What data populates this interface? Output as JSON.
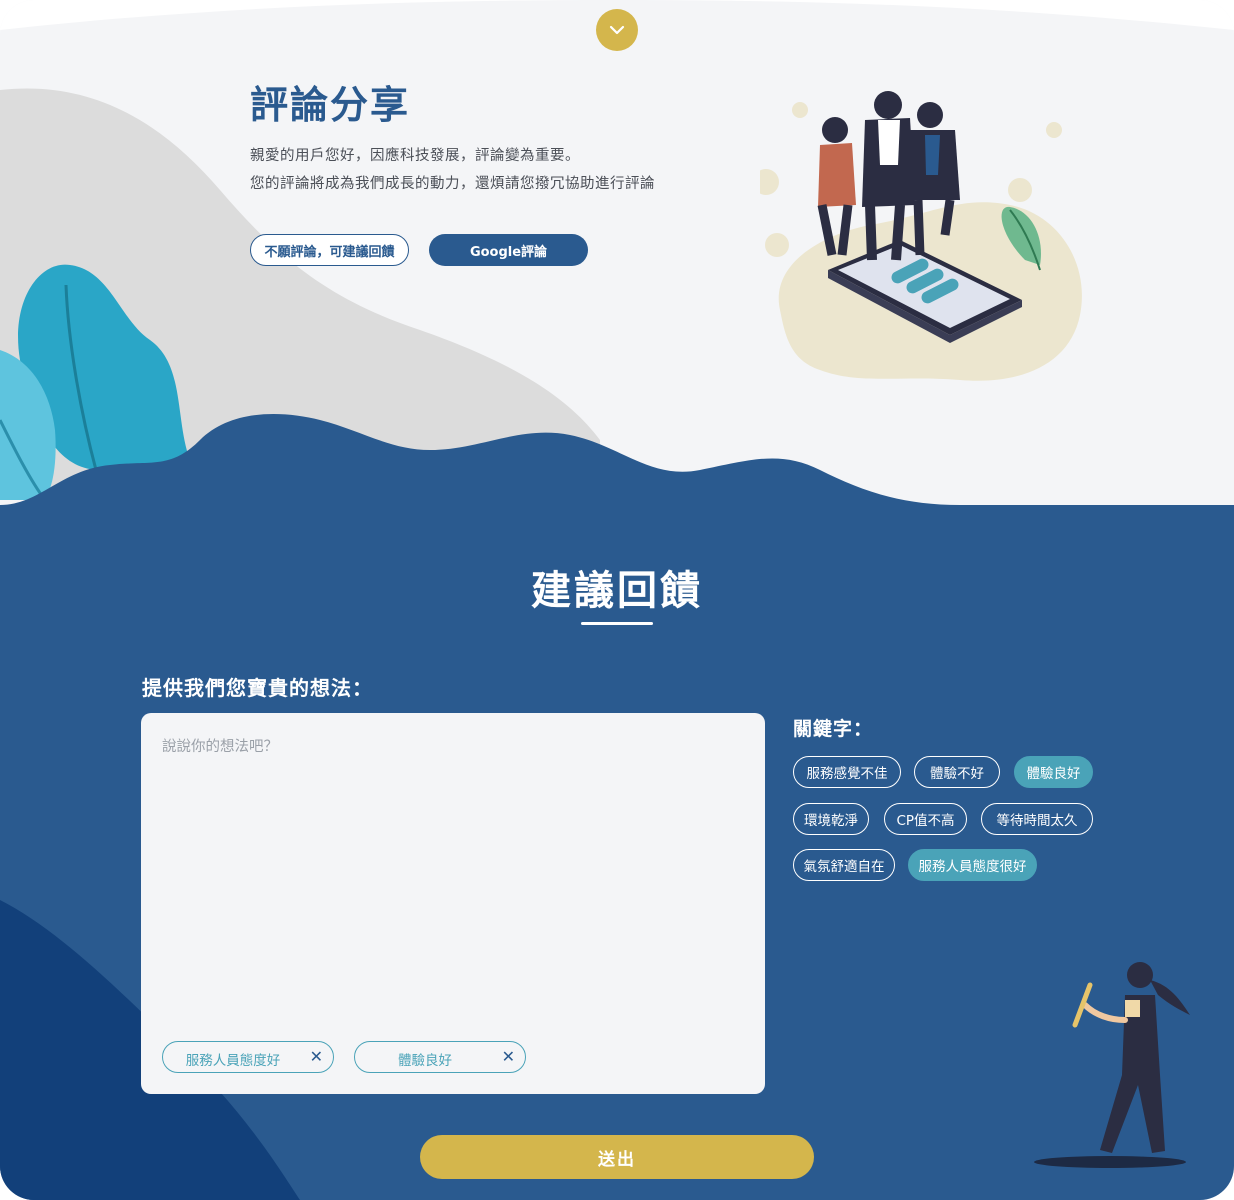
{
  "hero": {
    "title": "評論分享",
    "line1": "親愛的用戶您好，因應科技發展，評論變為重要。",
    "line2": "您的評論將成為我們成長的動力，還煩請您撥冗協助進行評論",
    "decline_button": "不願評論，可建議回饋",
    "google_button": "Google評論"
  },
  "feedback": {
    "title": "建議回饋",
    "prompt": "提供我們您寶貴的想法：",
    "placeholder": "說說你的想法吧？",
    "selected_keywords": [
      {
        "label": "服務人員態度好",
        "remove": "✕"
      },
      {
        "label": "體驗良好",
        "remove": "✕"
      }
    ],
    "keywords_label": "關鍵字：",
    "keywords": [
      {
        "label": "服務感覺不佳",
        "active": false
      },
      {
        "label": "體驗不好",
        "active": false
      },
      {
        "label": "體驗良好",
        "active": true
      },
      {
        "label": "環境乾淨",
        "active": false
      },
      {
        "label": "CP值不高",
        "active": false
      },
      {
        "label": "等待時間太久",
        "active": false
      },
      {
        "label": "氣氛舒適自在",
        "active": false
      },
      {
        "label": "服務人員態度很好",
        "active": true
      }
    ],
    "submit": "送出"
  },
  "colors": {
    "navy": "#2a5a8f",
    "gold": "#d4b64c",
    "teal": "#4aa3b8",
    "light_bg": "#f4f5f7"
  },
  "icons": {
    "scroll_down": "chevron-down-icon",
    "remove_chip": "close-icon"
  }
}
